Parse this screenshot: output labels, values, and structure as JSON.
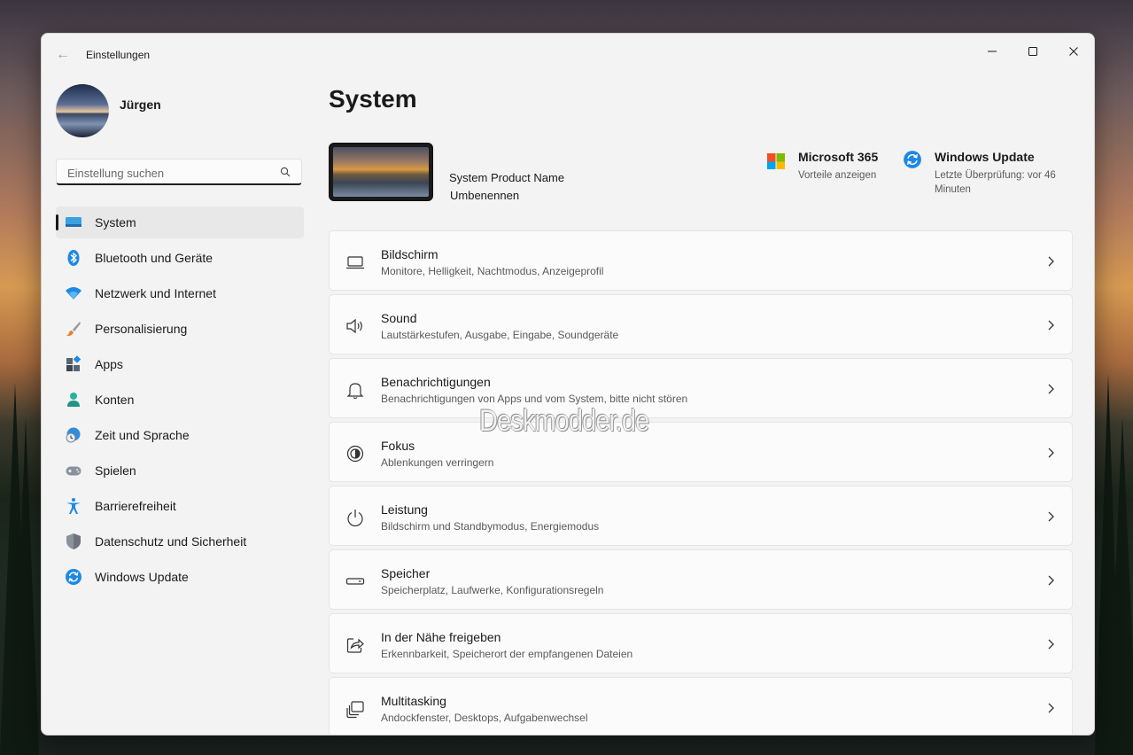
{
  "window": {
    "title": "Einstellungen"
  },
  "user": {
    "name": "Jürgen"
  },
  "search": {
    "placeholder": "Einstellung suchen"
  },
  "sidebar": {
    "items": [
      {
        "label": "System",
        "icon": "system-icon",
        "active": true
      },
      {
        "label": "Bluetooth und Geräte",
        "icon": "bluetooth-icon"
      },
      {
        "label": "Netzwerk und Internet",
        "icon": "wifi-icon"
      },
      {
        "label": "Personalisierung",
        "icon": "brush-icon"
      },
      {
        "label": "Apps",
        "icon": "apps-icon"
      },
      {
        "label": "Konten",
        "icon": "account-icon"
      },
      {
        "label": "Zeit und Sprache",
        "icon": "clock-globe-icon"
      },
      {
        "label": "Spielen",
        "icon": "gamepad-icon"
      },
      {
        "label": "Barrierefreiheit",
        "icon": "accessibility-icon"
      },
      {
        "label": "Datenschutz und Sicherheit",
        "icon": "shield-icon"
      },
      {
        "label": "Windows Update",
        "icon": "update-icon"
      }
    ]
  },
  "main": {
    "title": "System",
    "device": {
      "name": "System Product Name",
      "rename": "Umbenennen"
    },
    "tiles": [
      {
        "title": "Microsoft 365",
        "sub": "Vorteile anzeigen",
        "icon": "microsoft-logo-icon"
      },
      {
        "title": "Windows Update",
        "sub": "Letzte Überprüfung: vor 46 Minuten",
        "icon": "update-icon"
      }
    ],
    "cards": [
      {
        "title": "Bildschirm",
        "sub": "Monitore, Helligkeit, Nachtmodus, Anzeigeprofil",
        "icon": "display-icon"
      },
      {
        "title": "Sound",
        "sub": "Lautstärkestufen, Ausgabe, Eingabe, Soundgeräte",
        "icon": "speaker-icon"
      },
      {
        "title": "Benachrichtigungen",
        "sub": "Benachrichtigungen von Apps und vom System, bitte nicht stören",
        "icon": "bell-icon"
      },
      {
        "title": "Fokus",
        "sub": "Ablenkungen verringern",
        "icon": "focus-icon"
      },
      {
        "title": "Leistung",
        "sub": "Bildschirm und Standbymodus, Energiemodus",
        "icon": "power-icon"
      },
      {
        "title": "Speicher",
        "sub": "Speicherplatz, Laufwerke, Konfigurationsregeln",
        "icon": "storage-icon"
      },
      {
        "title": "In der Nähe freigeben",
        "sub": "Erkennbarkeit, Speicherort der empfangenen Dateien",
        "icon": "share-icon"
      },
      {
        "title": "Multitasking",
        "sub": "Andockfenster, Desktops, Aufgabenwechsel",
        "icon": "multitasking-icon"
      }
    ]
  },
  "watermark": "Deskmodder.de",
  "colors": {
    "accent": "#0067c0",
    "window_bg": "#f3f3f3",
    "card_bg": "#fbfbfb"
  }
}
